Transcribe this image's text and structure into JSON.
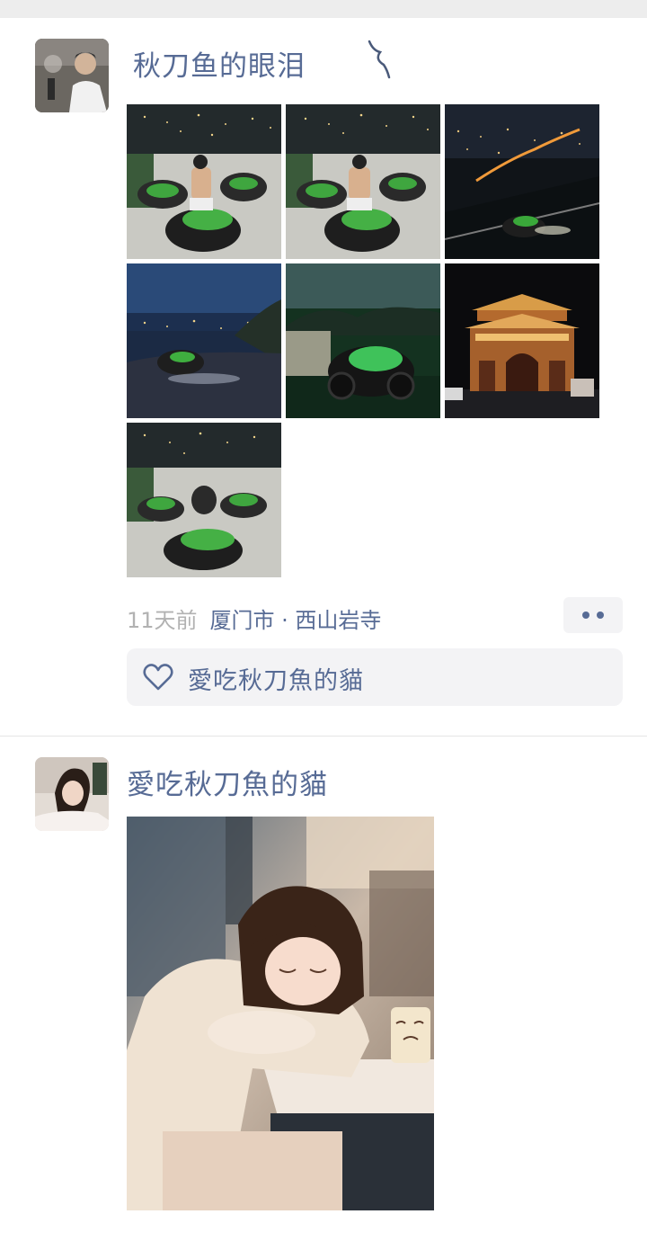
{
  "posts": [
    {
      "username": "秋刀鱼的眼泪",
      "avatar_icon": "avatar-man-photo",
      "photo_count": 7,
      "time": "11天前",
      "location": "厦门市 · 西山岩寺",
      "likes": [
        "愛吃秋刀魚的貓"
      ],
      "more_icon": "two-dots-icon",
      "like_icon": "heart-outline-icon"
    },
    {
      "username": "愛吃秋刀魚的貓",
      "avatar_icon": "avatar-woman-photo",
      "photo_count": 1
    }
  ],
  "colors": {
    "link": "#576b95",
    "muted": "#b2b2b2",
    "panel": "#f3f3f5",
    "divider": "#e5e5e5",
    "top_strip": "#ededed"
  }
}
